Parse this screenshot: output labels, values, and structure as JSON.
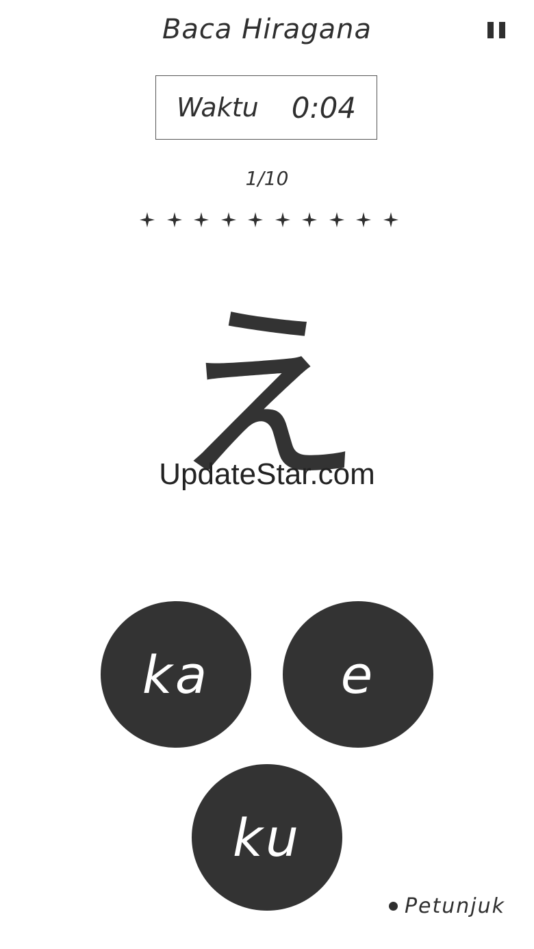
{
  "header": {
    "title": "Baca Hiragana",
    "pause_icon": "pause-icon"
  },
  "timer": {
    "label": "Waktu",
    "value": "0:04"
  },
  "progress": {
    "text": "1/10",
    "star_icon": "star-icon",
    "stars_total": 10
  },
  "question": {
    "kana": "え"
  },
  "watermark": {
    "text": "UpdateStar.com"
  },
  "options": [
    {
      "label": "ka"
    },
    {
      "label": "e"
    },
    {
      "label": "ku"
    }
  ],
  "hint": {
    "label": "Petunjuk"
  },
  "colors": {
    "text": "#2f2f2f",
    "button_bg": "#333333",
    "button_text": "#ffffff",
    "background": "#ffffff"
  }
}
